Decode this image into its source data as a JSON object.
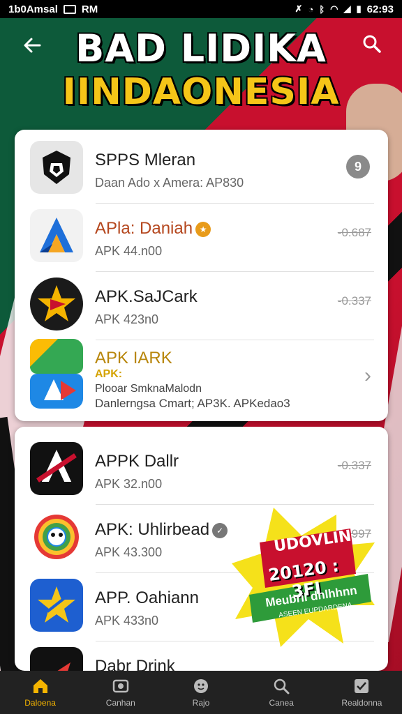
{
  "status_bar": {
    "left_text": "1b0Amsal",
    "mid_text": "RM",
    "time": "62:93"
  },
  "header": {
    "title_line1": "BAD LIDIKA",
    "title_line2": "IINDAONESIA",
    "back_icon": "back-arrow-icon",
    "search_icon": "search-icon"
  },
  "colors": {
    "accent": "#f5b400",
    "title_yellow": "#f5c518",
    "flag_red": "#c8102e",
    "green": "#0d5a3a"
  },
  "list1": [
    {
      "name": "SPPS Mleran",
      "sub": "Daan Ado x Amera: AP830",
      "trailing": "9",
      "trailing_type": "badge",
      "icon": "shield-logo-icon"
    },
    {
      "name": "APla: Daniah",
      "sub": "APK 44.n00",
      "trailing": "-0.687",
      "trailing_type": "size",
      "icon": "blue-a-logo-icon",
      "name_color": "#b5471e"
    },
    {
      "name": "APK.SaJCark",
      "sub": "APK 423n0",
      "trailing": "-0.337",
      "trailing_type": "size",
      "icon": "star-play-icon"
    },
    {
      "name": "APK IARK",
      "apk_label": "APK:",
      "desc1": "Plooar SmknaMalodn",
      "desc2": "Danlerngsa Cmart; AP3K. APKedao3",
      "trailing_type": "chevron",
      "icon": "google-style-icon"
    }
  ],
  "list2": [
    {
      "name": "APPK Dallr",
      "sub": "APK 32.n00",
      "trailing": "-0.337",
      "icon": "red-a-logo-icon"
    },
    {
      "name": "APK: Uhlirbead",
      "sub": "APK 43.300",
      "trailing": "0.997",
      "icon": "rainbow-face-icon"
    },
    {
      "name": "APP. Oahiann",
      "sub": "APK 433n0",
      "trailing": "",
      "icon": "star-blue-icon"
    },
    {
      "name": "Dabr Drink",
      "sub": "",
      "trailing": "",
      "icon": "red-arrow-icon"
    }
  ],
  "promo": {
    "line1": "UDOVLIN",
    "line2": "20120 : 3FI",
    "line3": "Meubril dnlhhnn",
    "line4": "ASEEN EUPDARDENA"
  },
  "bottom_nav": [
    {
      "label": "Daloena",
      "icon": "home-icon",
      "active": true
    },
    {
      "label": "Canhan",
      "icon": "photo-icon",
      "active": false
    },
    {
      "label": "Rajo",
      "icon": "face-icon",
      "active": false
    },
    {
      "label": "Canea",
      "icon": "search-icon",
      "active": false
    },
    {
      "label": "Realdonna",
      "icon": "check-icon",
      "active": false
    }
  ]
}
